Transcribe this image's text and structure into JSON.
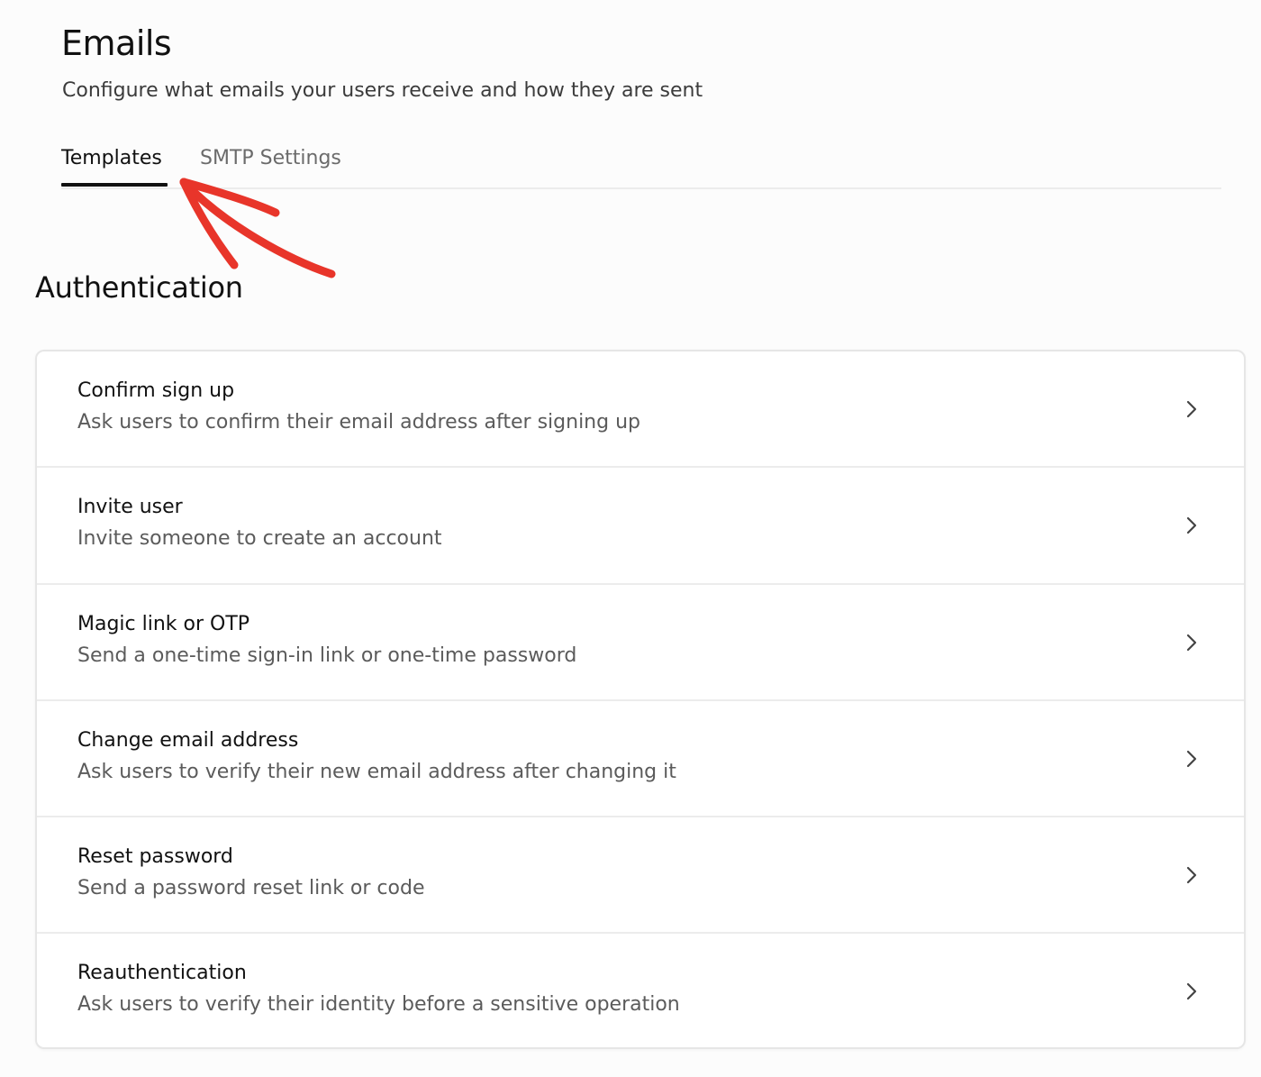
{
  "header": {
    "title": "Emails",
    "subtitle": "Configure what emails your users receive and how they are sent"
  },
  "tabs": [
    {
      "label": "Templates",
      "active": true
    },
    {
      "label": "SMTP Settings",
      "active": false
    }
  ],
  "annotation": {
    "type": "arrow",
    "color": "#e8352a",
    "points_to": "Templates tab"
  },
  "section": {
    "title": "Authentication"
  },
  "templates": [
    {
      "title": "Confirm sign up",
      "description": "Ask users to confirm their email address after signing up"
    },
    {
      "title": "Invite user",
      "description": "Invite someone to create an account"
    },
    {
      "title": "Magic link or OTP",
      "description": "Send a one-time sign-in link or one-time password"
    },
    {
      "title": "Change email address",
      "description": "Ask users to verify their new email address after changing it"
    },
    {
      "title": "Reset password",
      "description": "Send a password reset link or code"
    },
    {
      "title": "Reauthentication",
      "description": "Ask users to verify their identity before a sensitive operation"
    }
  ],
  "icons": {
    "row_action": "chevron-right-icon"
  }
}
